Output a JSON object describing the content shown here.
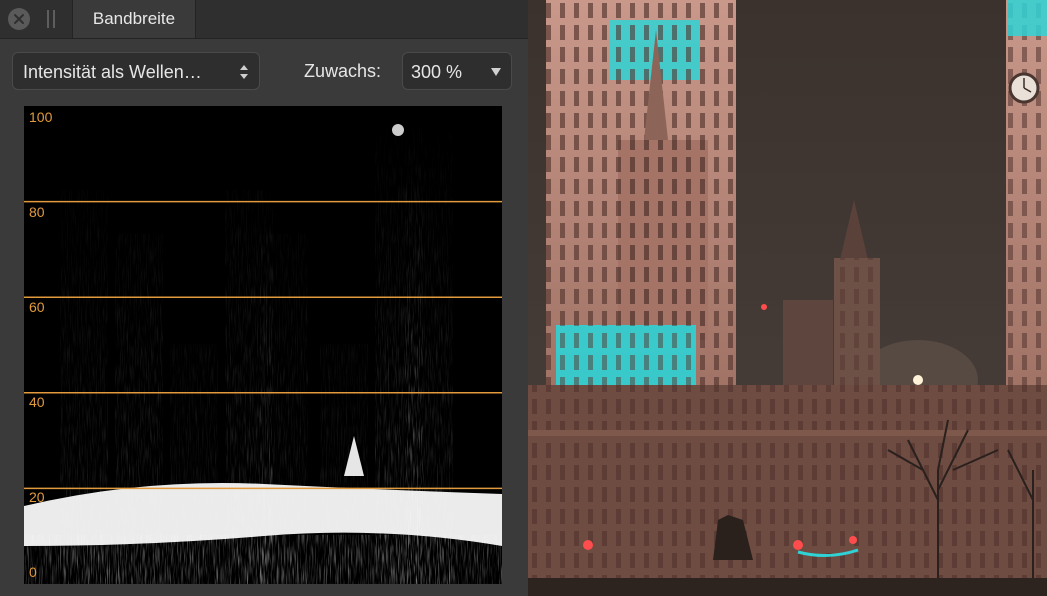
{
  "panel": {
    "tab_label": "Bandbreite",
    "mode_select": {
      "value": "Intensität als Wellen…"
    },
    "gain_label": "Zuwachs:",
    "gain_select": {
      "value": "300 %"
    }
  },
  "scope": {
    "scale_labels": [
      "100",
      "80",
      "60",
      "40",
      "20",
      "0"
    ],
    "line_color": "#e29a3c"
  },
  "colors": {
    "panel_bg": "#3a3a3a",
    "tabbar_bg": "#2f2f2f",
    "accent_orange": "#e29a3c",
    "photo_cyan": "#2fd3d6"
  },
  "icons": [
    "close-icon",
    "drag-grip-icon",
    "up-down-arrows-icon",
    "chevron-down-icon"
  ]
}
